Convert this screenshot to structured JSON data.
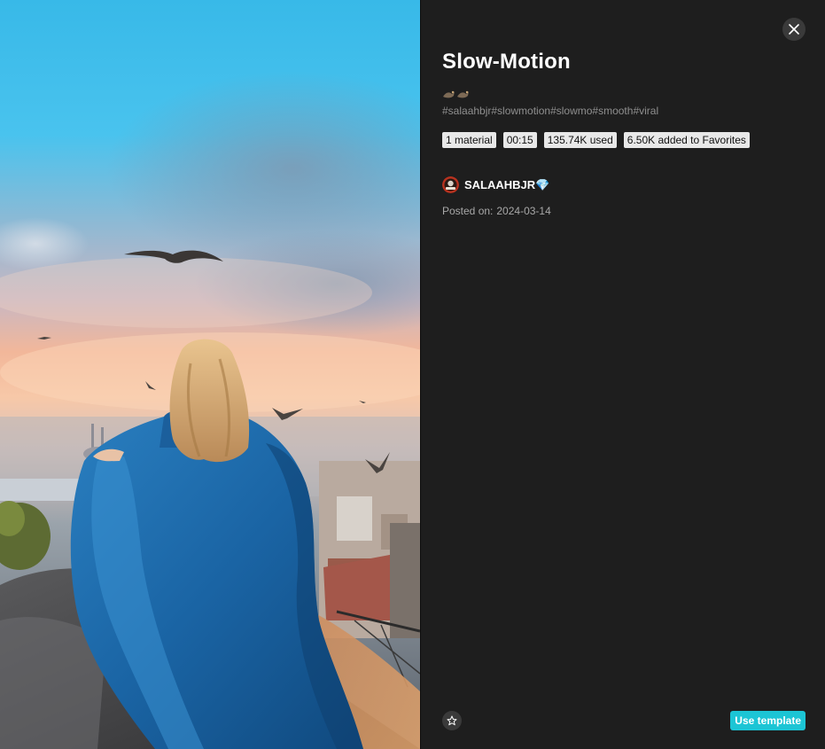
{
  "template": {
    "title": "Slow-Motion",
    "hashtags": "#salaahbjr#slowmotion#slowmo#smooth#viral",
    "badges": {
      "materials": "1 material",
      "duration": "00:15",
      "used": "135.74K used",
      "favorites": "6.50K added to Favorites"
    }
  },
  "author": {
    "name": "SALAAHBJR💎",
    "avatar_icon": "author-avatar"
  },
  "posted": {
    "label": "Posted on:",
    "date": "2024-03-14"
  },
  "actions": {
    "use_template_label": "Use template",
    "favorite_icon": "star-icon",
    "close_icon": "close-icon"
  },
  "colors": {
    "panel_bg": "#1e1e1e",
    "accent": "#1cc5d5",
    "badge_bg": "#e8e8e8",
    "muted_text": "#8f8f8f"
  }
}
